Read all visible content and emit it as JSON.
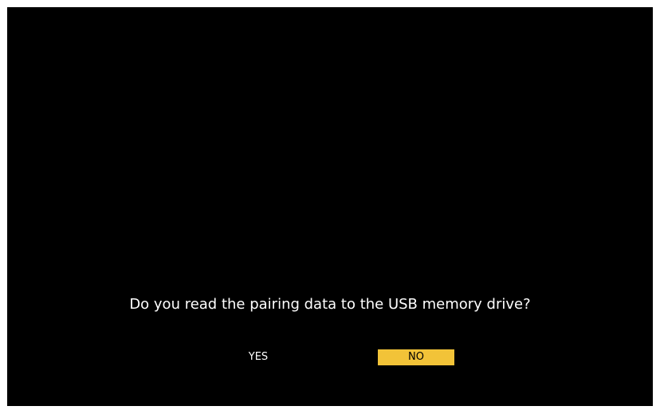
{
  "dialog": {
    "question": "Do you read the pairing data to the USB memory drive?",
    "options": [
      {
        "label": "YES",
        "selected": false
      },
      {
        "label": "NO",
        "selected": true
      }
    ]
  },
  "colors": {
    "background": "#000000",
    "text": "#ffffff",
    "highlight": "#f2c338",
    "highlight_text": "#000000"
  }
}
